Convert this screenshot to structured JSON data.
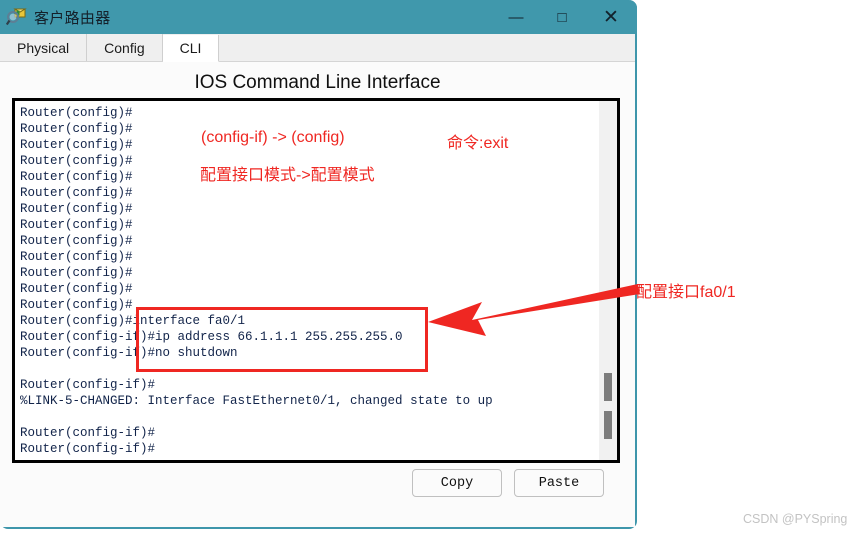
{
  "window": {
    "title": "客户路由器",
    "icon": "packet-tracer-magnifier-icon",
    "controls": {
      "minimize": "—",
      "maximize": "□",
      "close": "✕"
    },
    "accent_color": "#4098ac"
  },
  "tabs": [
    {
      "label": "Physical",
      "active": false
    },
    {
      "label": "Config",
      "active": false
    },
    {
      "label": "CLI",
      "active": true
    }
  ],
  "panel": {
    "heading": "IOS Command Line Interface"
  },
  "terminal": {
    "text": "Router(config)#\nRouter(config)#\nRouter(config)#\nRouter(config)#\nRouter(config)#\nRouter(config)#\nRouter(config)#\nRouter(config)#\nRouter(config)#\nRouter(config)#\nRouter(config)#\nRouter(config)#\nRouter(config)#\nRouter(config)#interface fa0/1\nRouter(config-if)#ip address 66.1.1.1 255.255.255.0\nRouter(config-if)#no shutdown\n\nRouter(config-if)#\n%LINK-5-CHANGED: Interface FastEthernet0/1, changed state to up\n\nRouter(config-if)#\nRouter(config-if)#",
    "text_color": "#12244a"
  },
  "buttons": {
    "copy": "Copy",
    "paste": "Paste"
  },
  "annotations": {
    "color": "#ef2722",
    "mode_transition": "(config-if) -> (config)",
    "command_label": "命令:exit",
    "mode_transition_cn": "配置接口模式->配置模式",
    "interface_label": "配置接口fa0/1"
  },
  "watermark": "CSDN @PYSpring"
}
